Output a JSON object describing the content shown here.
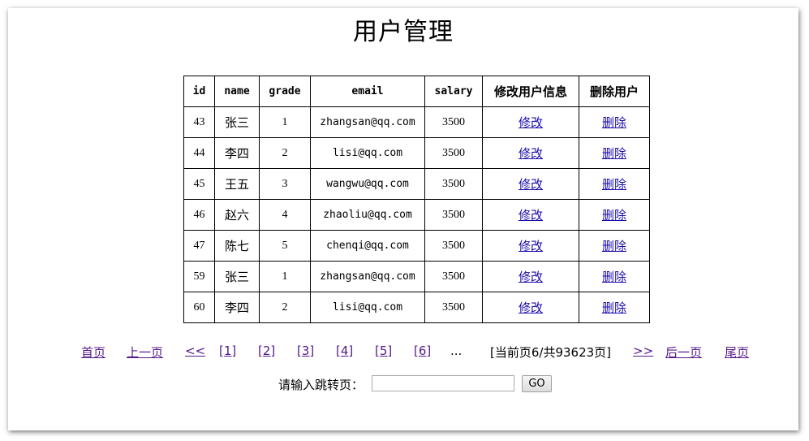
{
  "page": {
    "title": "用户管理"
  },
  "table": {
    "headers": [
      "id",
      "name",
      "grade",
      "email",
      "salary",
      "修改用户信息",
      "删除用户"
    ],
    "rows": [
      {
        "id": "43",
        "name": "张三",
        "grade": "1",
        "email": "zhangsan@qq.com",
        "salary": "3500",
        "edit": "修改",
        "delete": "删除"
      },
      {
        "id": "44",
        "name": "李四",
        "grade": "2",
        "email": "lisi@qq.com",
        "salary": "3500",
        "edit": "修改",
        "delete": "删除"
      },
      {
        "id": "45",
        "name": "王五",
        "grade": "3",
        "email": "wangwu@qq.com",
        "salary": "3500",
        "edit": "修改",
        "delete": "删除"
      },
      {
        "id": "46",
        "name": "赵六",
        "grade": "4",
        "email": "zhaoliu@qq.com",
        "salary": "3500",
        "edit": "修改",
        "delete": "删除"
      },
      {
        "id": "47",
        "name": "陈七",
        "grade": "5",
        "email": "chenqi@qq.com",
        "salary": "3500",
        "edit": "修改",
        "delete": "删除"
      },
      {
        "id": "59",
        "name": "张三",
        "grade": "1",
        "email": "zhangsan@qq.com",
        "salary": "3500",
        "edit": "修改",
        "delete": "删除"
      },
      {
        "id": "60",
        "name": "李四",
        "grade": "2",
        "email": "lisi@qq.com",
        "salary": "3500",
        "edit": "修改",
        "delete": "删除"
      }
    ]
  },
  "pager": {
    "first": "首页",
    "prev": "上一页",
    "prev_group": "<<",
    "pages": [
      "[1]",
      "[2]",
      "[3]",
      "[4]",
      "[5]",
      "[6]"
    ],
    "ellipsis": "...",
    "status": "[当前页6/共93623页]",
    "next_group": ">>",
    "next": "后一页",
    "last": "尾页"
  },
  "jump": {
    "label": "请输入跳转页：",
    "value": "",
    "button": "GO"
  },
  "colors": {
    "link": "#1a0dab",
    "visited_link": "#551a8b",
    "border": "#000000"
  }
}
